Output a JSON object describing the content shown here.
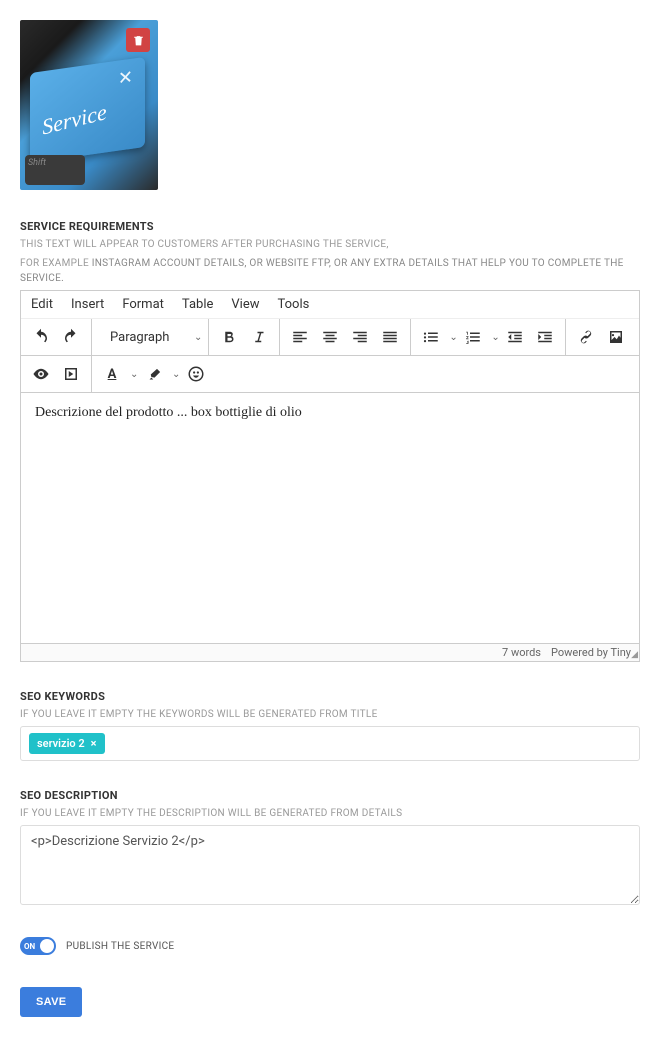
{
  "image": {
    "service_text": "Service",
    "shift_text": "Shift"
  },
  "requirements": {
    "label": "SERVICE REQUIREMENTS",
    "help1": "THIS TEXT WILL APPEAR TO CUSTOMERS AFTER PURCHASING THE SERVICE,",
    "help2_a": "FOR EXAMPLE ",
    "help2_b": "INSTAGRAM ACCOUNT DETAILS, OR WEBSITE FTP, OR ANY EXTRA DETAILS THAT HELP YOU TO COMPLETE THE SERVICE."
  },
  "editor": {
    "menu": {
      "edit": "Edit",
      "insert": "Insert",
      "format": "Format",
      "table": "Table",
      "view": "View",
      "tools": "Tools"
    },
    "format_select": "Paragraph",
    "content": "Descrizione del prodotto ... box bottiglie di olio",
    "footer": {
      "words": "7 words",
      "powered": "Powered by Tiny"
    }
  },
  "seo_keywords": {
    "label": "SEO KEYWORDS",
    "help": "IF YOU LEAVE IT EMPTY THE KEYWORDS WILL BE GENERATED FROM TITLE",
    "tags": [
      "servizio 2"
    ]
  },
  "seo_description": {
    "label": "SEO DESCRIPTION",
    "help": "IF YOU LEAVE IT EMPTY THE DESCRIPTION WILL BE GENERATED FROM DETAILS",
    "value": "<p>Descrizione Servizio 2</p>"
  },
  "publish": {
    "toggle_label": "ON",
    "text": "PUBLISH THE SERVICE"
  },
  "save": "SAVE"
}
